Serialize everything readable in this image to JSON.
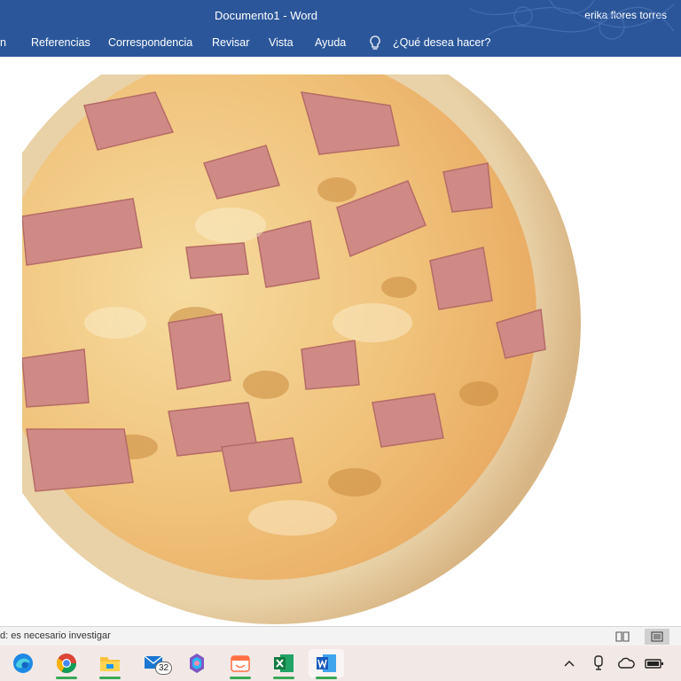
{
  "titlebar": {
    "doc_title": "Documento1  -  Word",
    "user": "erika flores torres"
  },
  "ribbon": {
    "tabs": [
      "n",
      "Referencias",
      "Correspondencia",
      "Revisar",
      "Vista",
      "Ayuda"
    ],
    "tell_me": "¿Qué desea hacer?"
  },
  "status": {
    "text": "d: es necesario investigar"
  },
  "taskbar": {
    "mail_badge": "32"
  },
  "colors": {
    "accent": "#2b579a",
    "taskbar": "#f2e9e6",
    "active_indicator": "#3aa856"
  },
  "icons": [
    "lightbulb-icon",
    "read-mode-icon",
    "print-layout-icon",
    "edge-icon",
    "chrome-icon",
    "file-explorer-icon",
    "mail-icon",
    "copilot-icon",
    "paint-icon",
    "excel-icon",
    "word-icon",
    "chevron-up-icon",
    "meet-now-icon",
    "onedrive-icon",
    "battery-icon"
  ]
}
